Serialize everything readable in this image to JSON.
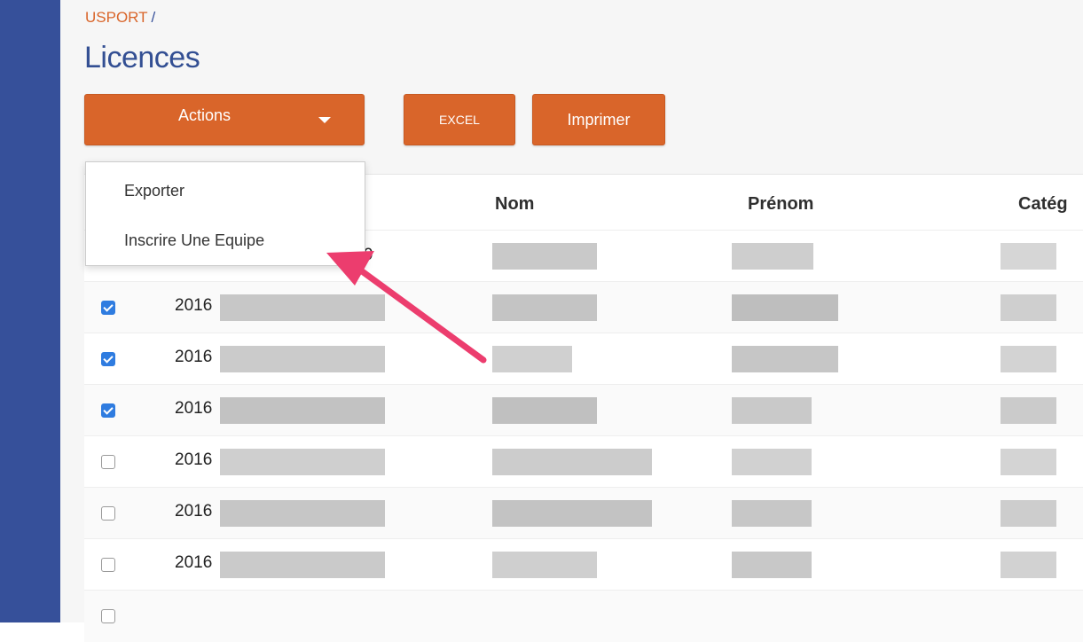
{
  "breadcrumb": {
    "root": "USPORT",
    "separator": "/"
  },
  "page": {
    "title": "Licences"
  },
  "toolbar": {
    "actions_label": "Actions",
    "excel_label": "EXCEL",
    "print_label": "Imprimer"
  },
  "actions_menu": {
    "items": [
      "Exporter",
      "Inscrire Une Equipe"
    ]
  },
  "table": {
    "headers": [
      "Nom",
      "Prénom",
      "Catég"
    ],
    "first_row_partial": "9",
    "rows": [
      {
        "checked": true,
        "year": "2016"
      },
      {
        "checked": true,
        "year": "2016"
      },
      {
        "checked": true,
        "year": "2016"
      },
      {
        "checked": false,
        "year": "2016"
      },
      {
        "checked": false,
        "year": "2016"
      },
      {
        "checked": false,
        "year": "2016"
      }
    ]
  },
  "colors": {
    "sidebar": "#36509a",
    "accent": "#d9652a",
    "title": "#334f93",
    "arrow": "#ec3d6e",
    "checkbox": "#2f7ce0"
  }
}
